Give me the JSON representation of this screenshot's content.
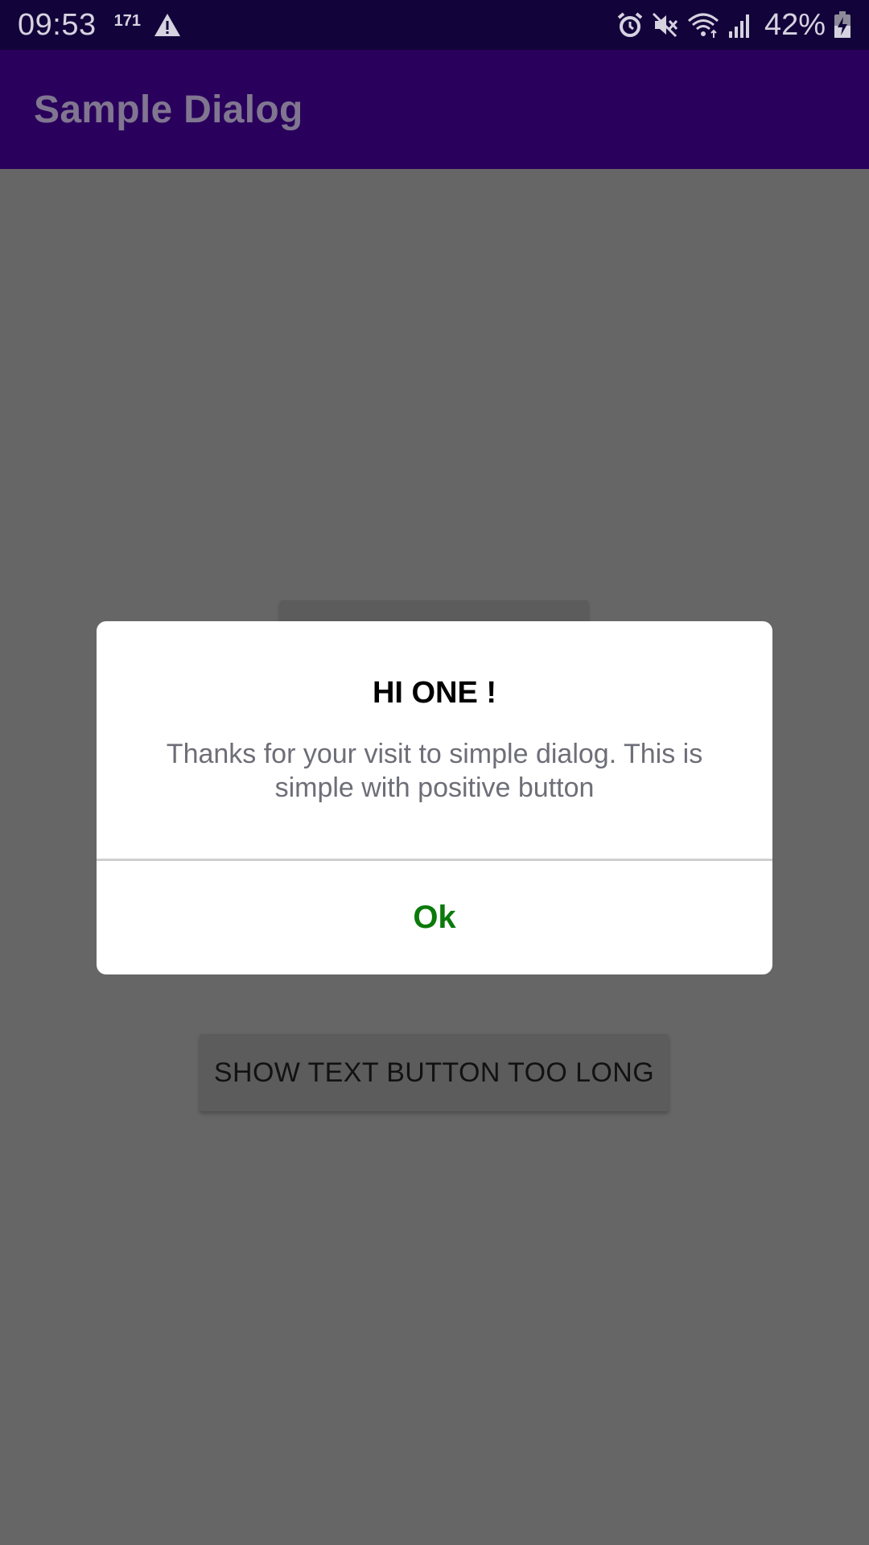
{
  "status_bar": {
    "time": "09:53",
    "notification_count": "171",
    "battery_percent": "42%",
    "icons": [
      "warning-icon",
      "alarm-icon",
      "mute-icon",
      "wifi-icon",
      "signal-icon",
      "battery-charging-icon"
    ]
  },
  "app_bar": {
    "title": "Sample Dialog"
  },
  "main": {
    "bottom_button_label": "SHOW TEXT BUTTON TOO LONG"
  },
  "dialog": {
    "title": "HI ONE !",
    "message": "Thanks for your visit to simple dialog. This is simple with positive button",
    "positive_button": "Ok"
  },
  "colors": {
    "status_bar": "#12043a",
    "app_bar": "#2a005d",
    "scrim": "#666666",
    "positive_button_text": "#0b7a0b"
  }
}
